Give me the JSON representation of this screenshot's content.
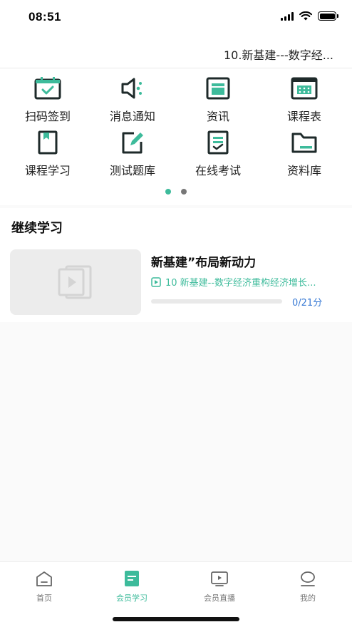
{
  "status_bar": {
    "time": "08:51"
  },
  "header": {
    "title": "10.新基建---数字经..."
  },
  "menu": {
    "items": [
      {
        "label": "扫码签到",
        "icon": "calendar-check-icon"
      },
      {
        "label": "消息通知",
        "icon": "speaker-icon"
      },
      {
        "label": "资讯",
        "icon": "news-icon"
      },
      {
        "label": "课程表",
        "icon": "schedule-icon"
      },
      {
        "label": "课程学习",
        "icon": "book-icon"
      },
      {
        "label": "测试题库",
        "icon": "edit-icon"
      },
      {
        "label": "在线考试",
        "icon": "exam-icon"
      },
      {
        "label": "资料库",
        "icon": "folder-icon"
      }
    ],
    "pages": 2,
    "active_page": 1
  },
  "continue_learning": {
    "title": "继续学习",
    "course": {
      "title": "新基建”布局新动力",
      "lesson": "10 新基建--数字经济重构经济增长...",
      "progress_text": "0/21分",
      "progress": 0.0
    }
  },
  "tab_bar": {
    "tabs": [
      {
        "label": "首页",
        "icon": "home-icon",
        "active": false
      },
      {
        "label": "会员学习",
        "icon": "study-icon",
        "active": true
      },
      {
        "label": "会员直播",
        "icon": "live-icon",
        "active": false
      },
      {
        "label": "我的",
        "icon": "profile-icon",
        "active": false
      }
    ]
  },
  "colors": {
    "accent": "#3dbb9b",
    "icon_dark": "#1e2a2a",
    "progress_text": "#3a7bd5"
  }
}
